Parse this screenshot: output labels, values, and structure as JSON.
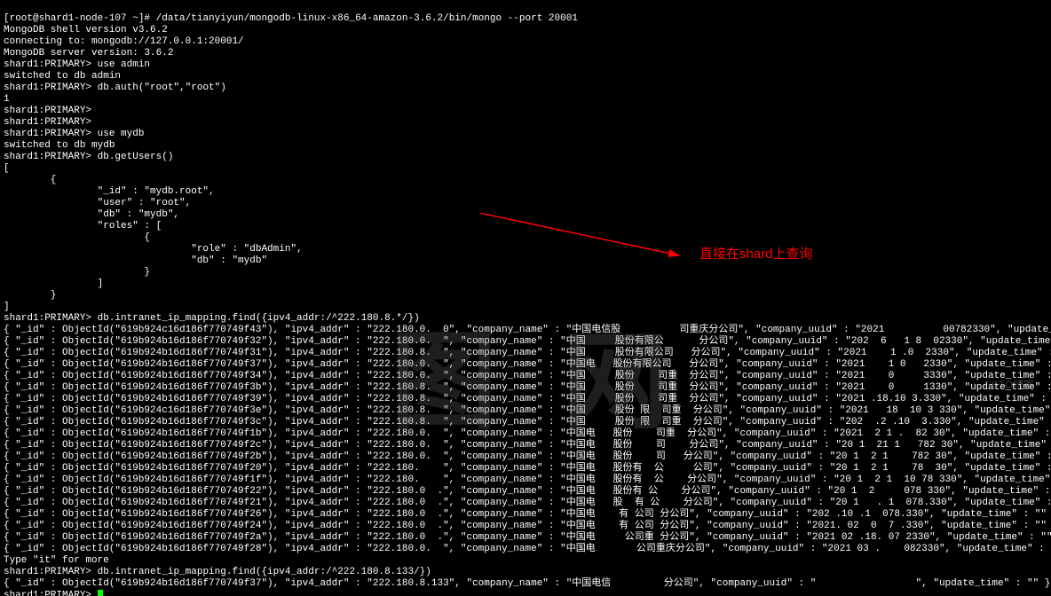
{
  "prompt_root": "[root@shard1-node-107 ~]# ",
  "cmd_mongo": "/data/tianyiyun/mongodb-linux-x86_64-amazon-3.6.2/bin/mongo --port 20001",
  "line_shell_ver": "MongoDB shell version v3.6.2",
  "line_connect": "connecting to: mongodb://127.0.0.1:20001/",
  "line_server_ver": "MongoDB server version: 3.6.2",
  "prompt_primary": "shard1:PRIMARY> ",
  "cmd_use_admin": "use admin",
  "res_switch_admin": "switched to db admin",
  "cmd_auth": "db.auth(\"root\",\"root\")",
  "res_auth": "1",
  "cmd_use_mydb": "use mydb",
  "res_switch_mydb": "switched to db mydb",
  "cmd_getusers": "db.getUsers()",
  "getusers_out": "[\n        {\n                \"_id\" : \"mydb.root\",\n                \"user\" : \"root\",\n                \"db\" : \"mydb\",\n                \"roles\" : [\n                        {\n                                \"role\" : \"dbAdmin\",\n                                \"db\" : \"mydb\"\n                        }\n                ]\n        }\n]",
  "cmd_find1": "db.intranet_ip_mapping.find({ipv4_addr:/^222.180.8.*/})",
  "rows": [
    {
      "oid": "619b924c16d186f770749f43",
      "ip": "222.180.0.  0",
      "cn": "中国电信股          司重庆分公司",
      "uuid": "2021          00782330"
    },
    {
      "oid": "619b924b16d186f770749f32",
      "ip": "222.180.0.  ",
      "cn": "中国     股份有限公      分公司",
      "uuid": "202  6   1 8  02330"
    },
    {
      "oid": "619b924b16d186f770749f31",
      "ip": "222.180.8.  ",
      "cn": "中国     股份有限公司   分公司",
      "uuid": "2021    1 .0  2330"
    },
    {
      "oid": "619b924b16d186f770749f37",
      "ip": "222.180.0.  ",
      "cn": "中国电   股份有限公司   分公司",
      "uuid": "2021    1 0   2330"
    },
    {
      "oid": "619b924b16d186f770749f34",
      "ip": "222.180.0.  ",
      "cn": "中国     股份    司重  分公司",
      "uuid": "2021    0     3330"
    },
    {
      "oid": "619b924b16d186f770749f3b",
      "ip": "222.180.8.  ",
      "cn": "中国     股份    司重  分公司",
      "uuid": "2021    0     1330"
    },
    {
      "oid": "619b924b16d186f770749f39",
      "ip": "222.180.8.  ",
      "cn": "中国     股份    司重  分公司",
      "uuid": "2021 .18.10 3.330"
    },
    {
      "oid": "619b924c16d186f770749f3e",
      "ip": "222.180.8.  ",
      "cn": "中国     股份 限  司重  分公司",
      "uuid": "2021   18  10 3 330"
    },
    {
      "oid": "619b924b16d186f770749f3c",
      "ip": "222.180.8.  ",
      "cn": "中国     股份 限  司重  分公司",
      "uuid": "202  .2 .10  3.330"
    },
    {
      "oid": "619b924b16d186f770749f1b",
      "ip": "222.180.0.  ",
      "cn": "中国电   股份    司重  分公司",
      "uuid": "2021  2 1 .  82 30"
    },
    {
      "oid": "619b924b16d186f770749f2c",
      "ip": "222.180.0.  ",
      "cn": "中国电   股份    司    分公司",
      "uuid": "20 1  21 1   782 30"
    },
    {
      "oid": "619b924b16d186f770749f2b",
      "ip": "222.180.0.  ",
      "cn": "中国电   股份    司   分公司",
      "uuid": "20 1  2 1    782 30"
    },
    {
      "oid": "619b924b16d186f770749f20",
      "ip": "222.180.    ",
      "cn": "中国电   股份有  公     公司",
      "uuid": "20 1  2 1    78  30"
    },
    {
      "oid": "619b924b16d186f770749f1f",
      "ip": "222.180.    ",
      "cn": "中国电   股份有  公    分公司",
      "uuid": "20 1  2 1  10 78 330"
    },
    {
      "oid": "619b924b16d186f770749f22",
      "ip": "222.180.0  .",
      "cn": "中国电   股份有 公    分公司",
      "uuid": "20 1  2     078 330"
    },
    {
      "oid": "619b924b16d186f770749f21",
      "ip": "222.180.0  .",
      "cn": "中国电   股  有 公    分公司",
      "uuid": "20 1   . 1  078.330"
    },
    {
      "oid": "619b924b16d186f770749f26",
      "ip": "222.180.0  .",
      "cn": "中国电    有 公司 分公司",
      "uuid": "202 .10 .1  078.330"
    },
    {
      "oid": "619b924b16d186f770749f24",
      "ip": "222.180.0  .",
      "cn": "中国电    有 公司 分公司",
      "uuid": "2021. 02  0  7 .330"
    },
    {
      "oid": "619b924b16d186f770749f2a",
      "ip": "222.180.0  .",
      "cn": "中国电     公司重 分公司",
      "uuid": "2021 02 .18. 07 2330"
    },
    {
      "oid": "619b924b16d186f770749f28",
      "ip": "222.180.0.  ",
      "cn": "中国电       公司重庆分公司",
      "uuid": "2021 03 .    082330"
    }
  ],
  "row_fmt_pre": "{ \"_id\" : ObjectId(\"",
  "row_fmt_ip": "\"), \"ipv4_addr\" : \"",
  "row_fmt_cn": "\", \"company_name\" : \"",
  "row_fmt_uuid": "\", \"company_uuid\" : \"",
  "row_fmt_end": "\", \"update_time\" : \"\" }",
  "type_it": "Type \"it\" for more",
  "cmd_find2": "db.intranet_ip_mapping.find({ipv4_addr:/^222.180.8.133/})",
  "res_find2": "{ \"_id\" : ObjectId(\"619b924b16d186f770749f37\"), \"ipv4_addr\" : \"222.180.8.133\", \"company_name\" : \"中国电信         分公司\", \"company_uuid\" : \"                 \", \"update_time\" : \"\" }",
  "annotation_text": "直接在shard上查询",
  "watermark_big": "图 网",
  "watermark_small": "CSTO博客"
}
